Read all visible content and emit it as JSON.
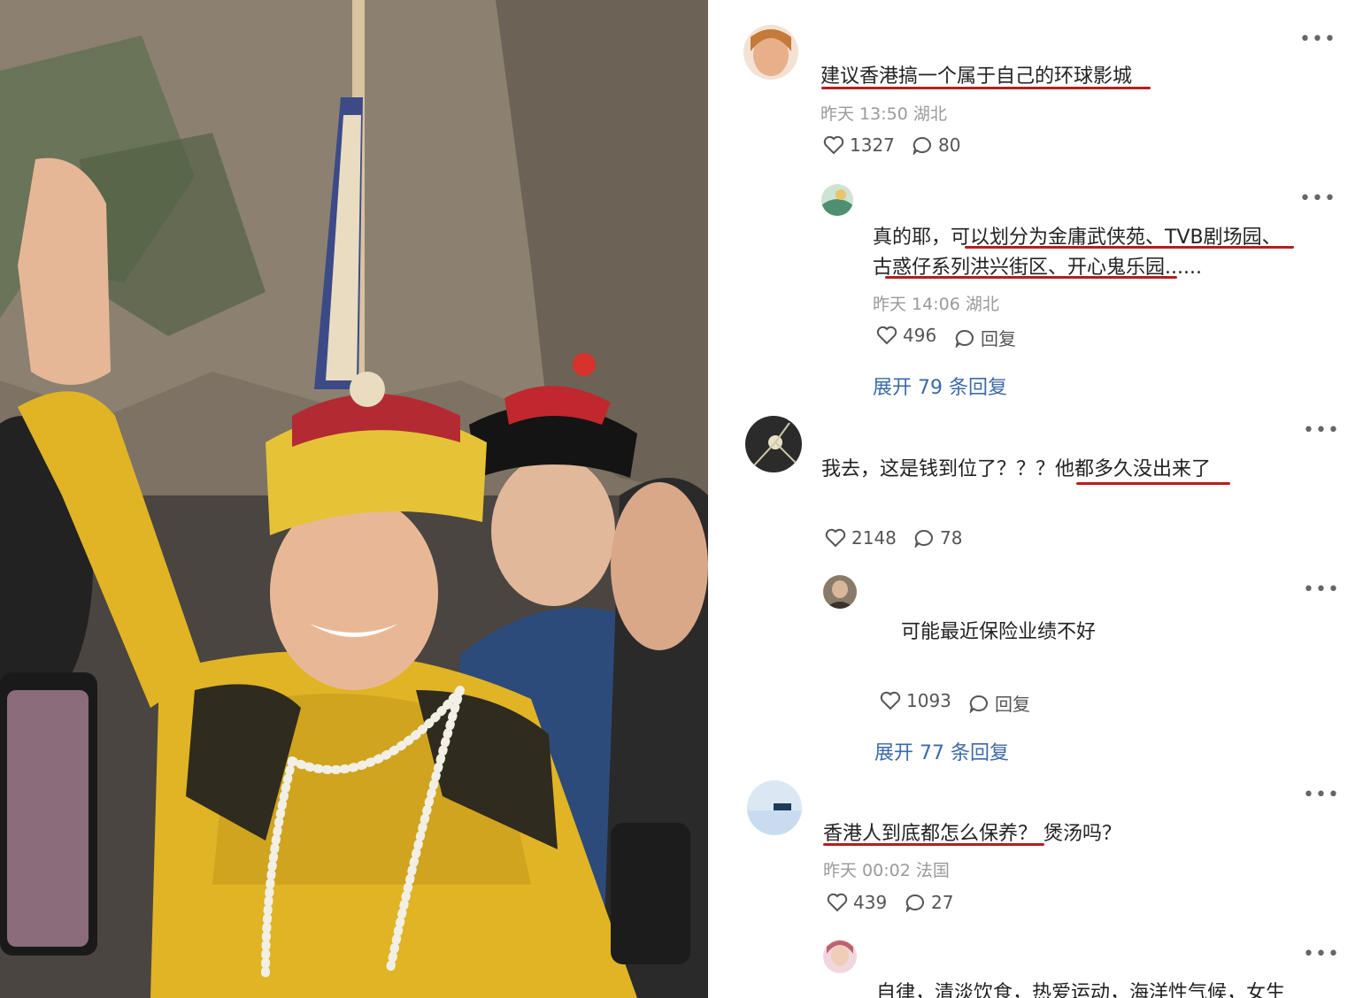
{
  "photo": {
    "description_icon": "photo-emperor-costume",
    "colors": {
      "robe": "#e0b424",
      "hat_rim": "#e6c237",
      "hat_top": "#b32a33",
      "rock": "#7a6e60",
      "attendant_coat": "#2c4b7a"
    }
  },
  "comments": [
    {
      "text": "建议香港搞一个属于自己的环球影城",
      "time": "昨天 13:50 湖北",
      "likes": "1327",
      "replies": "80",
      "avatar_color": "#e8b08a",
      "sub": {
        "line1_a": "真的耶，",
        "line1_b": "可以划分为金庸武侠苑、TVB剧场园、",
        "line2_a": "古惑仔系列洪兴街区、开心鬼乐园",
        "line2_b": "......",
        "time": "昨天 14:06 湖北",
        "likes": "496",
        "reply_label": "回复",
        "avatar_color": "#4f8f6f"
      },
      "expand": "展开 79 条回复"
    },
    {
      "text_a": "我去，这是钱到位了？？？",
      "text_b": "他都多久没出来了",
      "likes": "2148",
      "replies": "78",
      "avatar_color": "#2b2b2b",
      "sub": {
        "text": "可能最近保险业绩不好",
        "likes": "1093",
        "reply_label": "回复",
        "avatar_color": "#6b5a4a"
      },
      "expand": "展开 77 条回复"
    },
    {
      "text_a": "香港人到底都怎么保养？",
      "text_b": "煲汤吗？",
      "time": "昨天 00:02 法国",
      "likes": "439",
      "replies": "27",
      "avatar_color": "#c9dcef",
      "sub": {
        "text": "自律，清淡饮食，热爱运动，海洋性气候，女生",
        "avatar_color": "#c0626e"
      }
    }
  ],
  "accent_colors": {
    "underline": "#b41f1f",
    "link": "#3c6aa8"
  }
}
